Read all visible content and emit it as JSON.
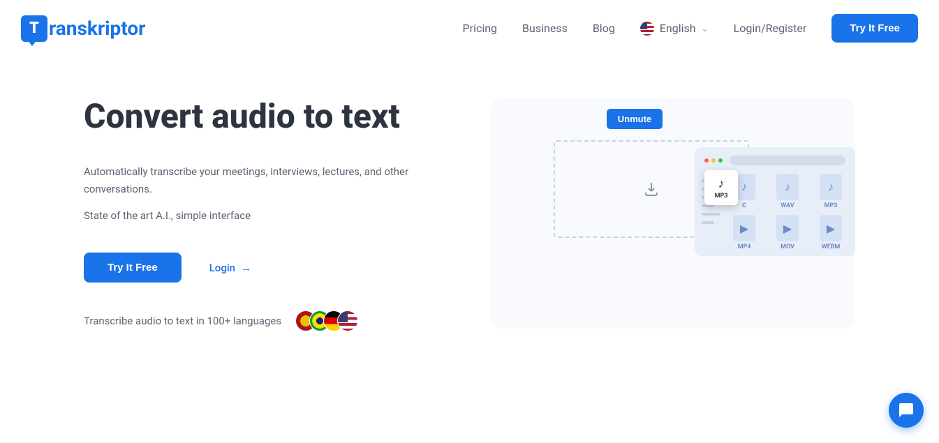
{
  "brand": "ranskriptor",
  "brand_letter": "T",
  "nav": {
    "pricing": "Pricing",
    "business": "Business",
    "blog": "Blog",
    "language": "English",
    "login_register": "Login/Register",
    "cta": "Try It Free"
  },
  "hero": {
    "title": "Convert audio to text",
    "desc1": "Automatically transcribe your meetings, interviews, lectures, and other conversations.",
    "desc2": "State of the art A.I., simple interface",
    "primary_btn": "Try It Free",
    "login_btn": "Login",
    "lang_note": "Transcribe audio to text in 100+ languages"
  },
  "demo": {
    "unmute": "Unmute",
    "dragged_file": "MP3",
    "files": [
      {
        "icon": "note",
        "label": "C"
      },
      {
        "icon": "note",
        "label": "WAV"
      },
      {
        "icon": "note",
        "label": "MP3"
      },
      {
        "icon": "play",
        "label": "MP4"
      },
      {
        "icon": "play",
        "label": "MOV"
      },
      {
        "icon": "play",
        "label": "WEBM"
      }
    ]
  }
}
